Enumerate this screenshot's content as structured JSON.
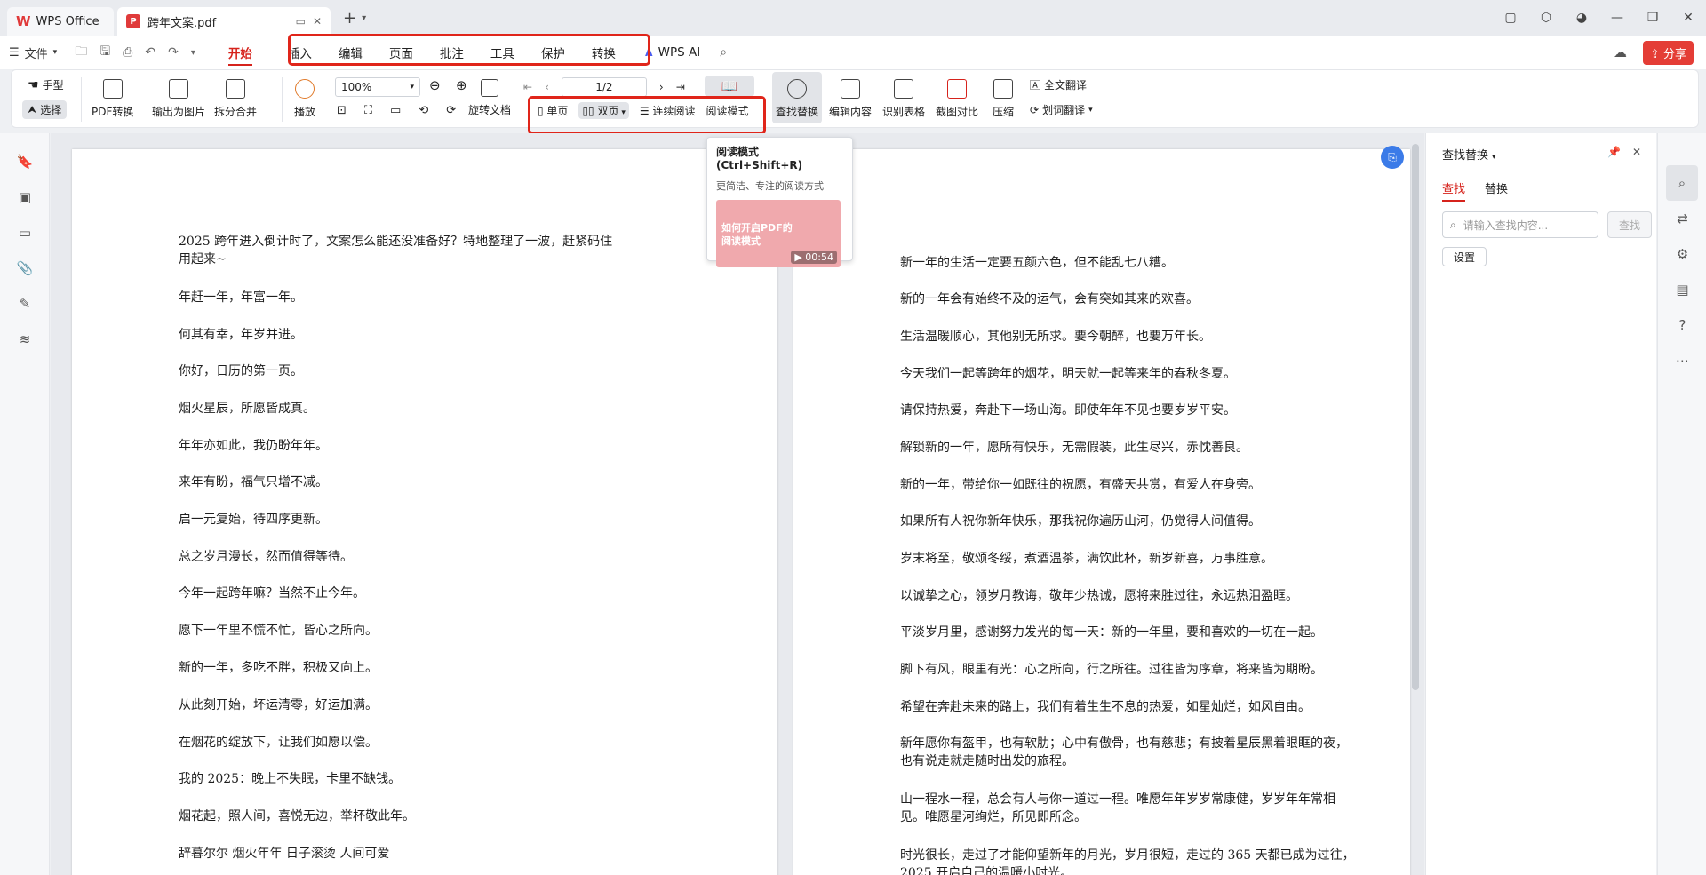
{
  "tabbar": {
    "wps_label": "WPS Office",
    "doc_title": "跨年文案.pdf",
    "new_tab": "+"
  },
  "menubar": {
    "file_label": "文件",
    "tabs": [
      "开始",
      "插入",
      "编辑",
      "页面",
      "批注",
      "工具",
      "保护",
      "转换"
    ],
    "wps_ai": "WPS AI",
    "share": "分享"
  },
  "toolbar": {
    "hand": "手型",
    "select": "选择",
    "pdf_convert": "PDF转换",
    "export_image": "输出为图片",
    "split_merge": "拆分合并",
    "play": "播放",
    "zoom": "100%",
    "rotate": "旋转文档",
    "page_input": "1/2",
    "single": "单页",
    "double": "双页",
    "continuous": "连续阅读",
    "read_mode": "阅读模式",
    "find_replace": "查找替换",
    "edit_content": "编辑内容",
    "recognize_table": "识别表格",
    "screenshot_compare": "截图对比",
    "compress": "压缩",
    "full_translate": "全文翻译",
    "word_translate": "划词翻译"
  },
  "tooltip": {
    "title": "阅读模式 (Ctrl+Shift+R)",
    "desc": "更简洁、专注的阅读方式",
    "thumb_title": "如何开启PDF的阅读模式",
    "duration": "00:54"
  },
  "left_page": [
    "2025 跨年进入倒计时了，文案怎么能还没准备好？特地整理了一波，赶紧码住",
    "用起来~",
    "年赶一年，年富一年。",
    "何其有幸，年岁并进。",
    "你好，日历的第一页。",
    "烟火星辰，所愿皆成真。",
    "年年亦如此，我仍盼年年。",
    "来年有盼，福气只增不减。",
    "启一元复始，待四序更新。",
    "总之岁月漫长，然而值得等待。",
    "今年一起跨年嘛？当然不止今年。",
    "愿下一年里不慌不忙，皆心之所向。",
    "新的一年，多吃不胖，积极又向上。",
    "从此刻开始，坏运清零，好运加满。",
    "在烟花的绽放下，让我们如愿以偿。",
    "我的 2025：晚上不失眠，卡里不缺钱。",
    "烟花起，照人间，喜悦无边，举杯敬此年。",
    "辞暮尔尔  烟火年年  日子滚烫  人间可爱"
  ],
  "right_page": [
    "新一年的生活一定要五颜六色，但不能乱七八糟。",
    "新的一年会有始终不及的运气，会有突如其来的欢喜。",
    "生活温暖顺心，其他别无所求。要今朝醉，也要万年长。",
    "今天我们一起等跨年的烟花，明天就一起等来年的春秋冬夏。",
    "请保持热爱，奔赴下一场山海。即使年年不见也要岁岁平安。",
    "解锁新的一年，愿所有快乐，无需假装，此生尽兴，赤忱善良。",
    "新的一年，带给你一如既往的祝愿，有盛天共赏，有爱人在身旁。",
    "如果所有人祝你新年快乐，那我祝你遍历山河，仍觉得人间值得。",
    "岁末将至，敬颂冬绥，煮酒温茶，满饮此杯，新岁新喜，万事胜意。",
    "以诚挚之心，领岁月教诲，敬年少热诚，愿将来胜过往，永远热泪盈眶。",
    "平淡岁月里，感谢努力发光的每一天：新的一年里，要和喜欢的一切在一起。",
    "脚下有风，眼里有光：心之所向，行之所往。过往皆为序章，将来皆为期盼。",
    "希望在奔赴未来的路上，我们有着生生不息的热爱，如星灿烂，如风自由。",
    "新年愿你有盔甲，也有软肋；心中有傲骨，也有慈悲；有披着星辰黑着眼眶的夜，",
    "也有说走就走随时出发的旅程。",
    "山一程水一程，总会有人与你一道过一程。唯愿年年岁岁常康健，岁岁年年常相",
    "见。唯愿星河绚烂，所见即所念。",
    "时光很长，走过了才能仰望新年的月光，岁月很短，走过的 365 天都已成为过往，",
    "2025 开启自己的温暖小时光。"
  ],
  "right_panel": {
    "title": "查找替换",
    "tab_find": "查找",
    "tab_replace": "替换",
    "placeholder": "请输入查找内容...",
    "find_button": "查找",
    "settings": "设置"
  },
  "colors": {
    "accent": "#d6231c",
    "highlight_box": "#e0251a"
  }
}
